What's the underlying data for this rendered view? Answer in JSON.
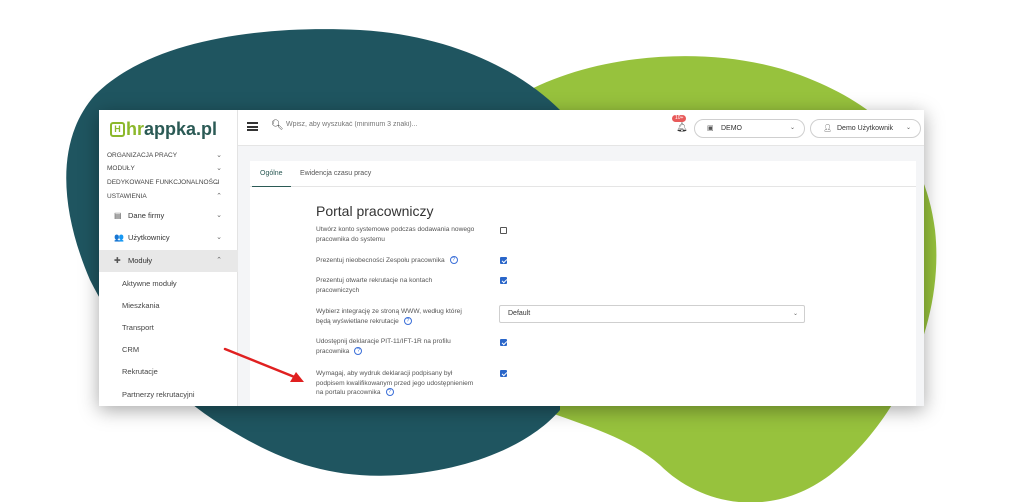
{
  "colors": {
    "teal_blob": "#1f5560",
    "green_blob": "#97c23d",
    "brand_green": "#8cb82c",
    "brand_teal": "#2b5a55",
    "accent_blue": "#2a66c9",
    "arrow_red": "#e02020"
  },
  "logo": {
    "box": "H",
    "hr": "hr",
    "rest": "appka.pl"
  },
  "sidebar": {
    "sections": [
      {
        "label": "ORGANIZACJA PRACY",
        "chevron": "chevron-down"
      },
      {
        "label": "MODUŁY",
        "chevron": "chevron-down"
      },
      {
        "label": "DEDYKOWANE FUNKCJONALNOŚCI",
        "chevron": "chevron-down"
      },
      {
        "label": "USTAWIENIA",
        "chevron": "chevron-up"
      }
    ],
    "sub": [
      {
        "label": "Dane firmy",
        "icon": "document-icon"
      },
      {
        "label": "Użytkownicy",
        "icon": "users-icon"
      },
      {
        "label": "Moduły",
        "icon": "puzzle-icon"
      }
    ],
    "leaves": [
      "Aktywne moduły",
      "Mieszkania",
      "Transport",
      "CRM",
      "Rekrutacje",
      "Partnerzy rekrutacyjni"
    ]
  },
  "topbar": {
    "search_placeholder": "Wpisz, aby wyszukać (minimum 3 znaki)...",
    "notif_count": "10+",
    "company": "DEMO",
    "user": "Demo Użytkownik"
  },
  "tabs": [
    "Ogólne",
    "Ewidencja czasu pracy"
  ],
  "section_title": "Portal pracowniczy",
  "settings": [
    {
      "label": "Utwórz konto systemowe podczas dodawania nowego pracownika do systemu",
      "checked": false,
      "help": false
    },
    {
      "label": "Prezentuj nieobecności Zespołu pracownika",
      "checked": true,
      "help": true
    },
    {
      "label": "Prezentuj otwarte rekrutacje na kontach pracowniczych",
      "checked": true,
      "help": false
    },
    {
      "label": "Wybierz integrację ze stroną WWW, według której będą wyświetlane rekrutacje",
      "help": true,
      "select_value": "Default"
    },
    {
      "label": "Udostępnij deklaracje PIT-11/IFT-1R na profilu pracownika",
      "checked": true,
      "help": true
    },
    {
      "label": "Wymagaj, aby wydruk deklaracji podpisany był podpisem kwalifikowanym przed jego udostępnieniem na portalu pracownika",
      "checked": true,
      "help": true
    }
  ]
}
